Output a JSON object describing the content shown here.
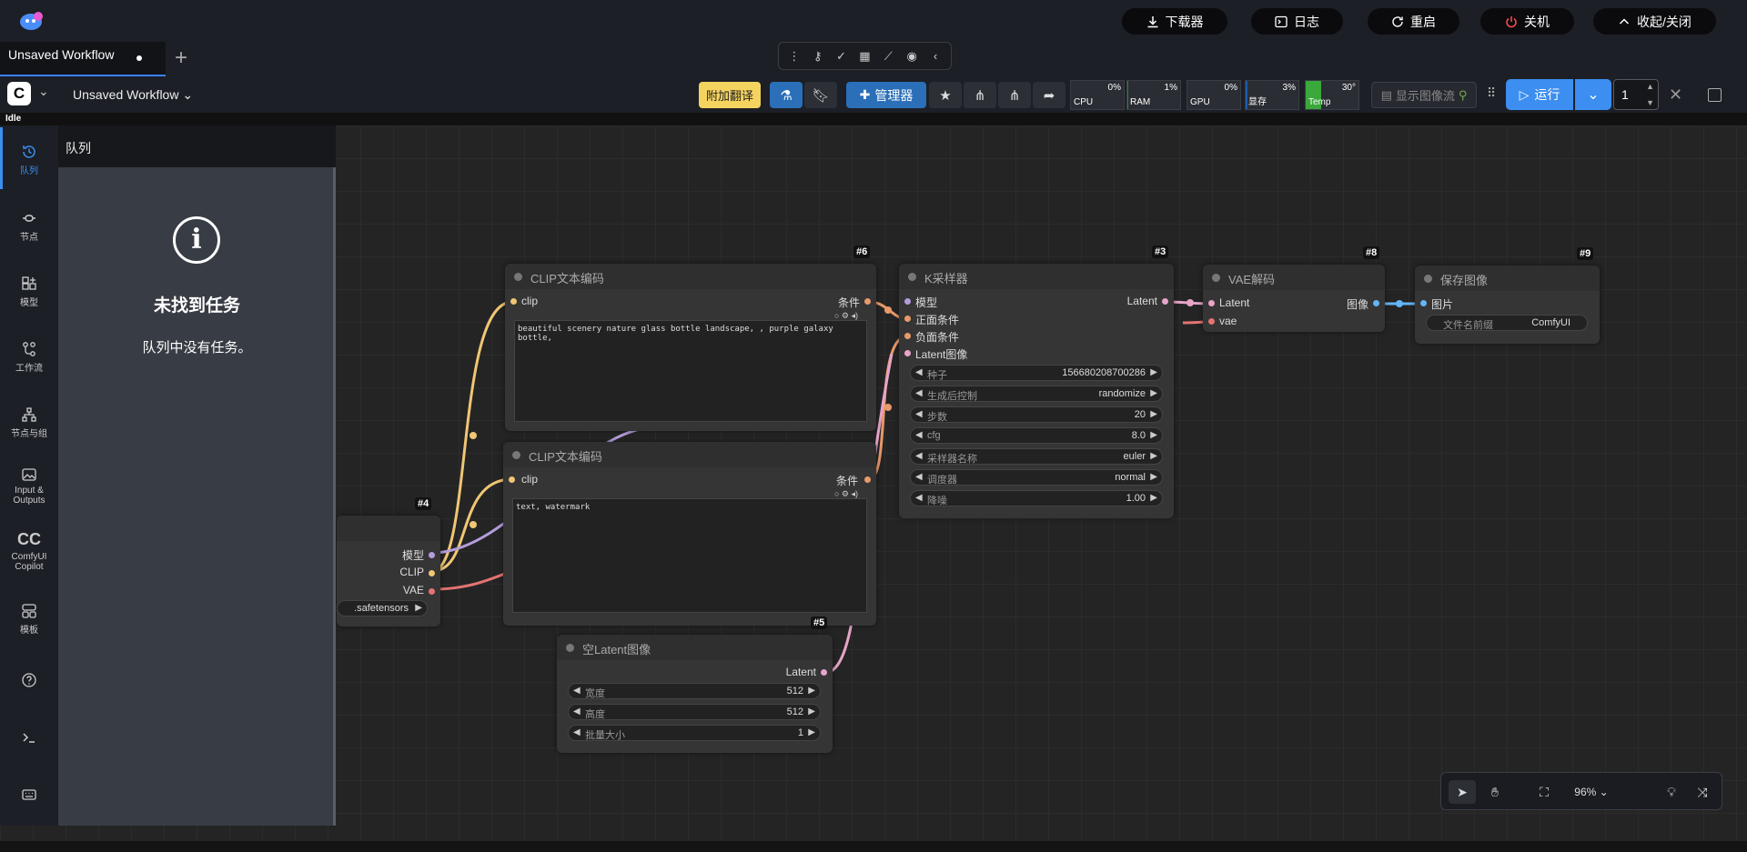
{
  "titlebar": {
    "download": "下载器",
    "logs": "日志",
    "restart": "重启",
    "shutdown": "关机",
    "collapse": "收起/关闭"
  },
  "tabs": [
    {
      "label": "Unsaved Workflow"
    }
  ],
  "toolbar": {
    "workflow_name": "Unsaved Workflow",
    "translate": "附加翻译",
    "manager": "管理器",
    "monitor": {
      "cpu": {
        "label": "CPU",
        "value": "0%"
      },
      "ram": {
        "label": "RAM",
        "value": "1%"
      },
      "gpu": {
        "label": "GPU",
        "value": "0%"
      },
      "vram": {
        "label": "显存",
        "value": "3%"
      },
      "temp": {
        "label": "Temp",
        "value": "30°"
      }
    },
    "image_stream": "显示图像流",
    "run": "运行",
    "batch_count": "1"
  },
  "status": "Idle",
  "sidebar": {
    "items": [
      {
        "label": "队列"
      },
      {
        "label": "节点"
      },
      {
        "label": "模型"
      },
      {
        "label": "工作流"
      },
      {
        "label": "节点与组"
      },
      {
        "label": "Input &"
      },
      {
        "label": "Outputs"
      },
      {
        "label": "ComfyUI"
      },
      {
        "label": "Copilot"
      },
      {
        "label": "模板"
      }
    ]
  },
  "queue_panel": {
    "title": "队列",
    "empty_title": "未找到任务",
    "empty_sub": "队列中没有任务。"
  },
  "nodes": {
    "clip_pos": {
      "id": "#6",
      "title": "CLIP文本编码",
      "input": "clip",
      "output": "条件",
      "text": "beautiful scenery nature glass bottle landscape, , purple galaxy bottle,"
    },
    "clip_neg": {
      "id": "",
      "title": "CLIP文本编码",
      "input": "clip",
      "output": "条件",
      "text": "text, watermark"
    },
    "ksampler": {
      "id": "#3",
      "title": "K采样器",
      "inputs": [
        "模型",
        "正面条件",
        "负面条件",
        "Latent图像"
      ],
      "output": "Latent",
      "widgets": [
        {
          "label": "种子",
          "value": "156680208700286"
        },
        {
          "label": "生成后控制",
          "value": "randomize"
        },
        {
          "label": "步数",
          "value": "20"
        },
        {
          "label": "cfg",
          "value": "8.0"
        },
        {
          "label": "采样器名称",
          "value": "euler"
        },
        {
          "label": "调度器",
          "value": "normal"
        },
        {
          "label": "降噪",
          "value": "1.00"
        }
      ]
    },
    "vae_decode": {
      "id": "#8",
      "title": "VAE解码",
      "inputs": [
        "Latent",
        "vae"
      ],
      "output": "图像"
    },
    "save_image": {
      "id": "#9",
      "title": "保存图像",
      "input": "图片",
      "widget": {
        "label": "文件名前缀",
        "value": "ComfyUI"
      }
    },
    "checkpoint": {
      "id": "#4",
      "outputs": [
        "模型",
        "CLIP",
        "VAE"
      ],
      "widget_value": ".safetensors"
    },
    "empty_latent": {
      "id": "#5",
      "title": "空Latent图像",
      "output": "Latent",
      "widgets": [
        {
          "label": "宽度",
          "value": "512"
        },
        {
          "label": "高度",
          "value": "512"
        },
        {
          "label": "批量大小",
          "value": "1"
        }
      ]
    }
  },
  "canvas_tools": {
    "zoom": "96%"
  },
  "colors": {
    "accent": "#3c8ef0",
    "clip_wire": "#f0c674",
    "model_wire": "#b39ddb",
    "vae_wire": "#e57373",
    "cond_wire": "#e89a6a",
    "latent_wire": "#e8a4c9",
    "image_wire": "#64b5f6"
  }
}
